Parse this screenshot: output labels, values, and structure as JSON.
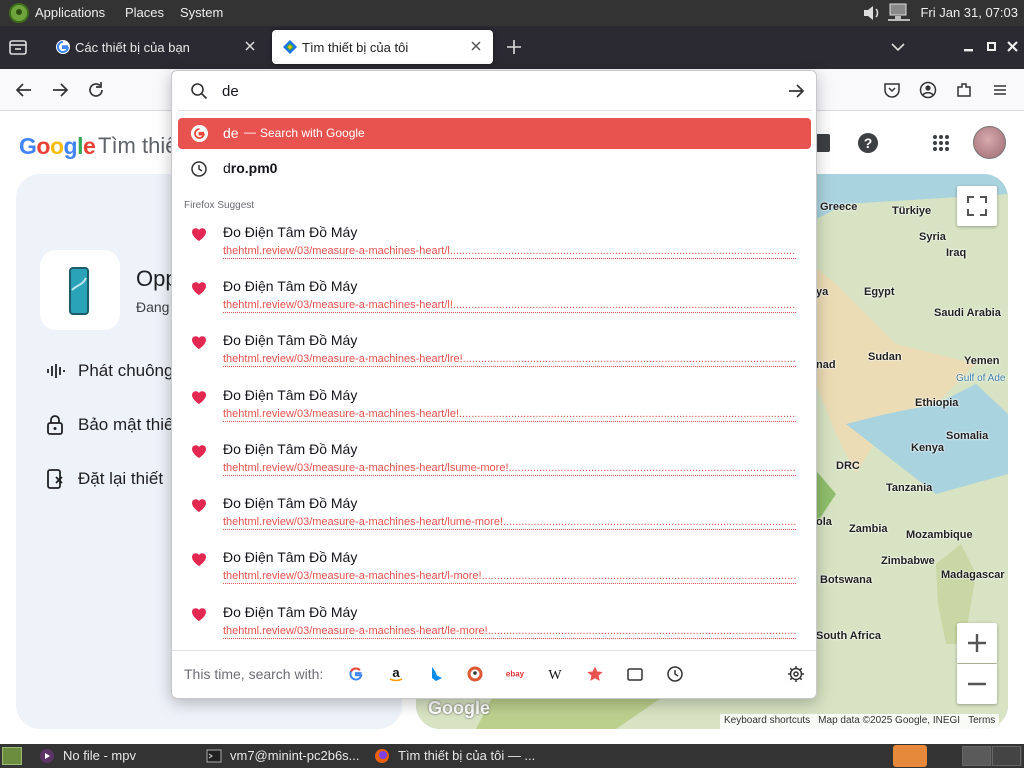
{
  "system_panel": {
    "menus": [
      "Applications",
      "Places",
      "System"
    ],
    "clock": "Fri Jan 31, 07:03"
  },
  "tabs": [
    {
      "title": "Các thiết bị của bạn",
      "active": false
    },
    {
      "title": "Tìm thiết bị của tôi",
      "active": true
    }
  ],
  "page": {
    "logo": [
      "G",
      "o",
      "o",
      "g",
      "l",
      "e"
    ],
    "logo_colors": [
      "#4285f4",
      "#ea4335",
      "#fbbc05",
      "#4285f4",
      "#34a853",
      "#ea4335"
    ],
    "heading": "Tìm thiế",
    "device_name": "Opp",
    "device_status": "Đang",
    "actions": [
      "Phát chuông",
      "Bảo mật thiế",
      "Đặt lại thiết"
    ],
    "map": {
      "labels": [
        "Greece",
        "Türkiye",
        "Syria",
        "Iraq",
        "Egypt",
        "Saudi Arabia",
        "Sudan",
        "Yemen",
        "Gulf of Ade",
        "Ethiopia",
        "Somalia",
        "DRC",
        "Kenya",
        "Tanzania",
        "Zambia",
        "Mozambique",
        "Zimbabwe",
        "Botswana",
        "Madagascar",
        "South Africa",
        "ya",
        "nad",
        "ola"
      ],
      "google_logo": "Google",
      "footer": [
        "Keyboard shortcuts",
        "Map data ©2025 Google, INEGI",
        "Terms"
      ]
    }
  },
  "urlbar": {
    "query": "de",
    "search_row": {
      "query": "de",
      "dash": "—",
      "action": "Search with Google"
    },
    "history_row": {
      "prefix": "d",
      "rest": "ro.pm0"
    },
    "group_label": "Firefox Suggest",
    "suggestions": [
      {
        "title": "Đo Điện Tâm Đồ Máy",
        "url": "thehtml.review/03/measure-a-machines-heart/l......................................................................................................................l"
      },
      {
        "title": "Đo Điện Tâm Đồ Máy",
        "url": "thehtml.review/03/measure-a-machines-heart/l!.....................................................................................................................l"
      },
      {
        "title": "Đo Điện Tâm Đồ Máy",
        "url": "thehtml.review/03/measure-a-machines-heart/lre!...................................................................................................................l"
      },
      {
        "title": "Đo Điện Tâm Đồ Máy",
        "url": "thehtml.review/03/measure-a-machines-heart/le!....................................................................................................................l"
      },
      {
        "title": "Đo Điện Tâm Đồ Máy",
        "url": "thehtml.review/03/measure-a-machines-heart/lsume-more!..........................................................................................................."
      },
      {
        "title": "Đo Điện Tâm Đồ Máy",
        "url": "thehtml.review/03/measure-a-machines-heart/lume-more!............................................................................................................"
      },
      {
        "title": "Đo Điện Tâm Đồ Máy",
        "url": "thehtml.review/03/measure-a-machines-heart/l-more!................................................................................................................"
      },
      {
        "title": "Đo Điện Tâm Đồ Máy",
        "url": "thehtml.review/03/measure-a-machines-heart/le-more!..............................................................................................................."
      }
    ],
    "oneoff_label": "This time, search with:",
    "engines": [
      "google-icon",
      "amazon-icon",
      "bing-icon",
      "duckduckgo-icon",
      "ebay-icon",
      "wikipedia-icon",
      "bookmarks-icon",
      "tabs-icon",
      "history-icon"
    ],
    "engine_texts": {
      "ebay": "ebay",
      "wikipedia": "W",
      "amazon": "a"
    }
  },
  "taskbar": {
    "tasks": [
      "No file - mpv",
      "vm7@minint-pc2b6s...",
      "Tìm thiết bị của tôi — ..."
    ]
  },
  "colors": {
    "accent": "#e8524f",
    "panel": "#333333",
    "tab_strip": "#2b2a33"
  }
}
